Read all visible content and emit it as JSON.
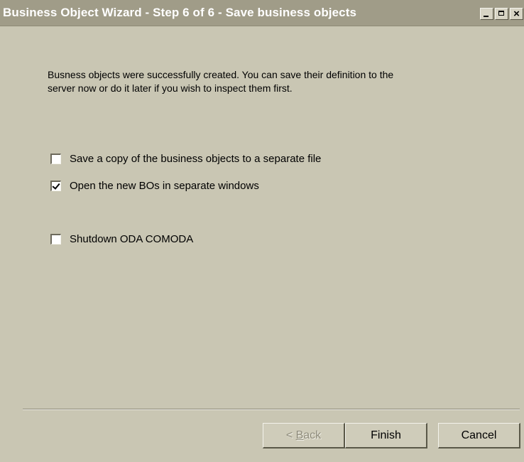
{
  "window": {
    "title": "Business Object Wizard - Step 6 of 6 - Save business objects",
    "controls": {
      "minimize": "minimize-icon",
      "maximize": "maximize-icon",
      "close": "×"
    }
  },
  "intro": {
    "line1": "Busness objects were successfully created. You can save their definition to the",
    "line2": "server now or do it later if you wish to inspect them first."
  },
  "options": [
    {
      "label": "Save a copy of the business objects to a separate file",
      "checked": false
    },
    {
      "label": "Open the new BOs in separate windows",
      "checked": true
    },
    {
      "label": "Shutdown ODA COMODA",
      "checked": false
    }
  ],
  "buttons": {
    "back_prefix": "< ",
    "back_underlined": "B",
    "back_rest": "ack",
    "back_enabled": false,
    "finish": "Finish",
    "cancel": "Cancel"
  },
  "colors": {
    "face": "#c9c6b3",
    "titlebar": "#a09c88"
  }
}
